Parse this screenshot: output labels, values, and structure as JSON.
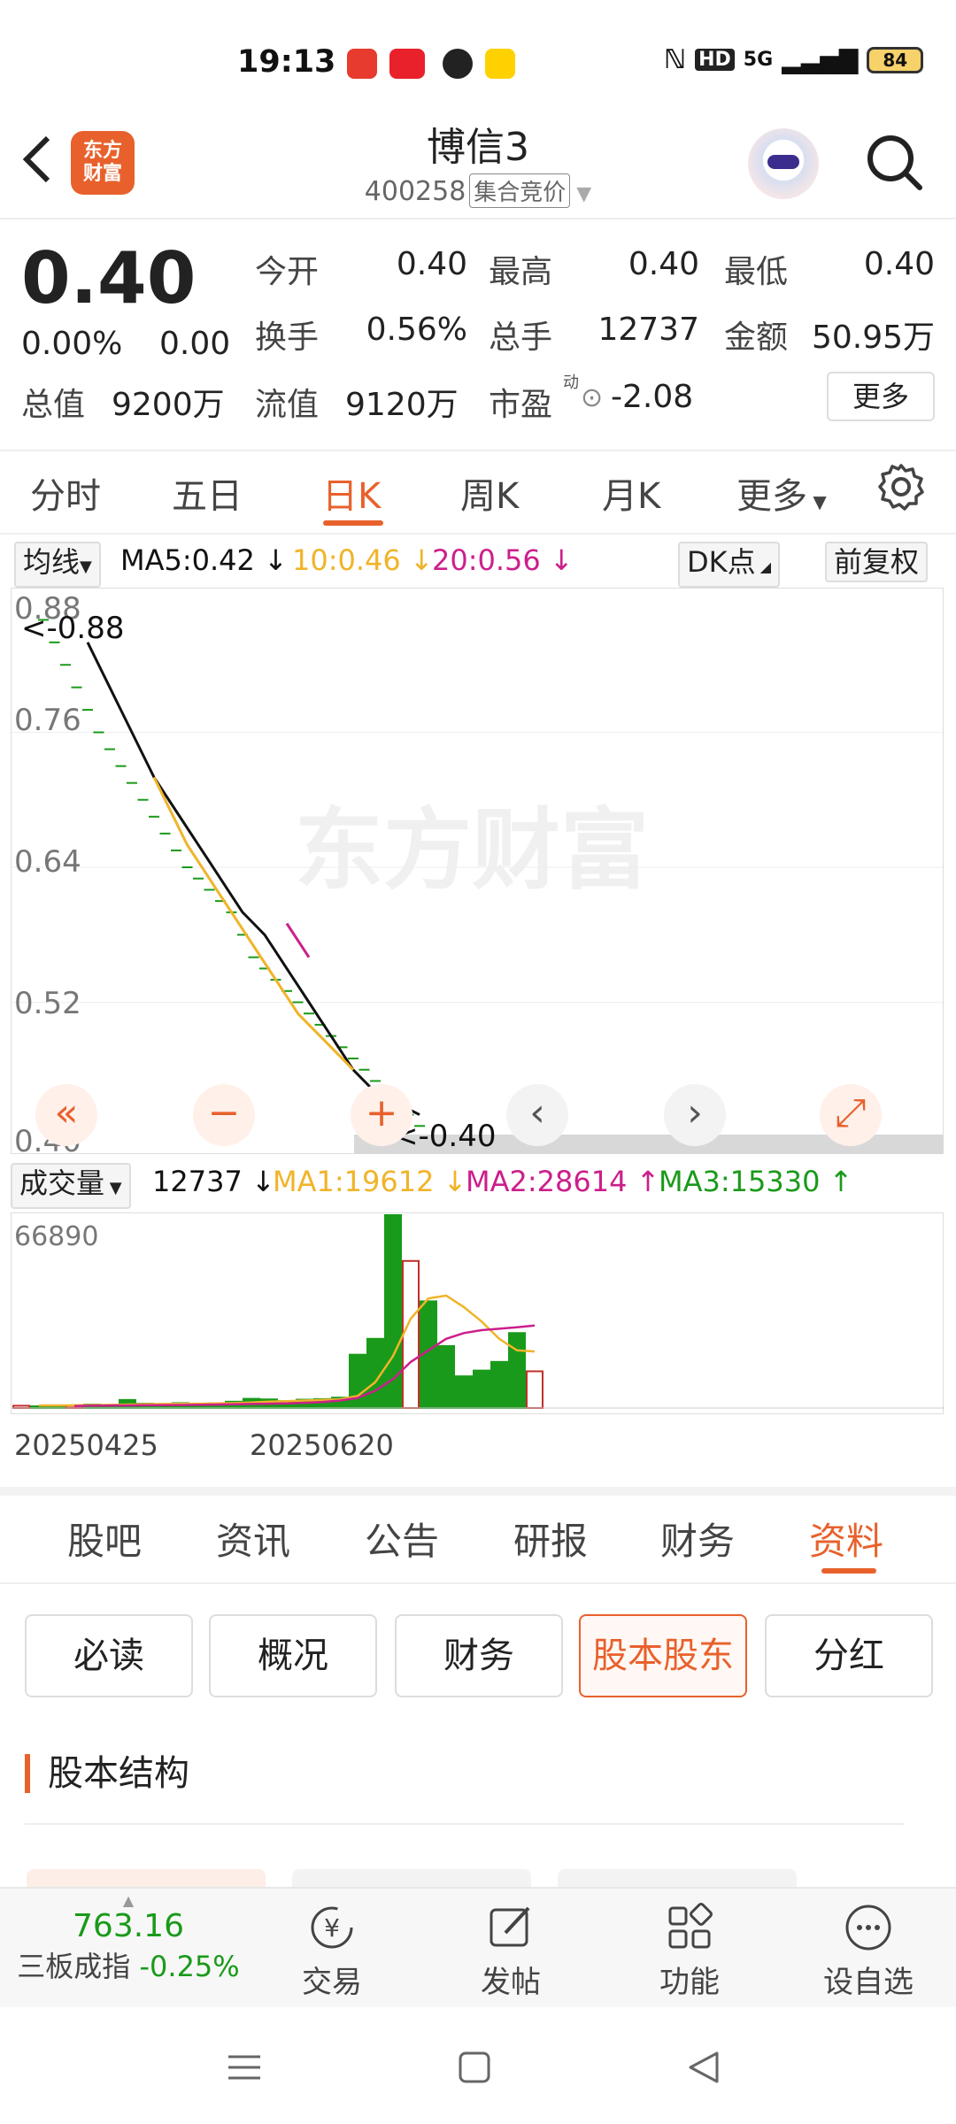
{
  "status_bar": {
    "time": "19:13",
    "icons": [
      "play-app",
      "toutiao-app",
      "feishu-app",
      "meituan-app"
    ],
    "right_labels": {
      "hd": "HD",
      "net": "5G"
    },
    "battery": "84"
  },
  "header": {
    "back": "‹",
    "logo_line1": "东方",
    "logo_line2": "财富",
    "title": "博信3",
    "code": "400258",
    "tag": "集合竞价"
  },
  "quote": {
    "price": "0.40",
    "change_pct": "0.00%",
    "change": "0.00",
    "rows": [
      [
        {
          "label": "今开",
          "value": "0.40"
        },
        {
          "label": "最高",
          "value": "0.40"
        },
        {
          "label": "最低",
          "value": "0.40"
        }
      ],
      [
        {
          "label": "换手",
          "value": "0.56%"
        },
        {
          "label": "总手",
          "value": "12737"
        },
        {
          "label": "金额",
          "value": "50.95万"
        }
      ]
    ],
    "total_value_label": "总值",
    "total_value": "9200万",
    "float_value_label": "流值",
    "float_value": "9120万",
    "pe_label": "市盈",
    "pe_super": "动",
    "pe_value": "-2.08",
    "more": "更多"
  },
  "chart_tabs": {
    "items": [
      "分时",
      "五日",
      "日K",
      "周K",
      "月K",
      "更多"
    ],
    "active": "日K"
  },
  "ma_bar": {
    "selector": "均线",
    "ma5": "MA5:0.42",
    "ma10": "10:0.46",
    "ma20": "20:0.56",
    "dk": "DK点",
    "fq": "前复权"
  },
  "colors": {
    "accent": "#e8612c",
    "ma5": "#111111",
    "ma10": "#f0b429",
    "ma20": "#cc1f8c",
    "down": "#1a9a1a",
    "up": "#c0302a"
  },
  "chart_data": {
    "type": "line",
    "title": "",
    "y_ticks": [
      "0.88",
      "0.76",
      "0.64",
      "0.52",
      "0.40"
    ],
    "ylim": [
      0.4,
      0.88
    ],
    "max_label": "<-0.88",
    "min_label": "<-0.40",
    "watermark": "东方财富",
    "candles_close": [
      0.86,
      0.84,
      0.82,
      0.8,
      0.78,
      0.76,
      0.745,
      0.73,
      0.715,
      0.7,
      0.685,
      0.67,
      0.655,
      0.64,
      0.63,
      0.62,
      0.61,
      0.6,
      0.58,
      0.56,
      0.55,
      0.54,
      0.53,
      0.52,
      0.51,
      0.5,
      0.49,
      0.48,
      0.47,
      0.46,
      0.45,
      0.44,
      0.43,
      0.42,
      0.41,
      0.4
    ],
    "series": [
      {
        "name": "MA5",
        "values": [
          0.84,
          0.82,
          0.8,
          0.78,
          0.76,
          0.74,
          0.72,
          0.705,
          0.69,
          0.675,
          0.66,
          0.645,
          0.63,
          0.615,
          0.6,
          0.59,
          0.58,
          0.565,
          0.55,
          0.535,
          0.52,
          0.505,
          0.49,
          0.475,
          0.46,
          0.45,
          0.44,
          0.435,
          0.43,
          0.425,
          0.42
        ]
      },
      {
        "name": "MA10",
        "values": [
          0.72,
          0.7,
          0.68,
          0.66,
          0.645,
          0.63,
          0.615,
          0.6,
          0.585,
          0.57,
          0.555,
          0.54,
          0.525,
          0.51,
          0.5,
          0.49,
          0.48,
          0.47,
          0.46
        ]
      },
      {
        "name": "MA20",
        "values": [
          0.59,
          0.575,
          0.56
        ]
      }
    ]
  },
  "controls": [
    "«",
    "−",
    "+",
    "‹",
    "›",
    "⤢"
  ],
  "volume_bar": {
    "selector": "成交量",
    "vol": "12737",
    "ma1": "MA1:19612",
    "ma2": "MA2:28614",
    "ma3": "MA3:15330"
  },
  "volume_chart_data": {
    "type": "bar",
    "max_label": "66890",
    "values": [
      800,
      600,
      900,
      700,
      1200,
      900,
      2800,
      1500,
      1200,
      1700,
      1400,
      1600,
      2200,
      3200,
      3000,
      2400,
      2900,
      3100,
      3600,
      18500,
      24000,
      66890,
      51000,
      37000,
      21500,
      11000,
      13000,
      16000,
      26000,
      12737
    ],
    "colors": [
      "up",
      "down",
      "down",
      "up",
      "down",
      "down",
      "down",
      "down",
      "down",
      "down",
      "down",
      "down",
      "down",
      "down",
      "down",
      "down",
      "down",
      "down",
      "down",
      "down",
      "down",
      "down",
      "up",
      "down",
      "down",
      "down",
      "down",
      "down",
      "down",
      "up"
    ],
    "ma1": [
      900,
      900,
      950,
      1000,
      1100,
      1200,
      1300,
      1400,
      1450,
      1500,
      1600,
      1700,
      1900,
      2200,
      2400,
      2600,
      2800,
      3000,
      4200,
      9000,
      18000,
      31000,
      38000,
      39000,
      35000,
      30000,
      24000,
      20000,
      19612
    ],
    "ma2": [
      700,
      800,
      850,
      900,
      950,
      1000,
      1050,
      1100,
      1200,
      1300,
      1400,
      1500,
      1600,
      1800,
      2100,
      2600,
      3500,
      6000,
      10000,
      16000,
      20000,
      24000,
      26000,
      27000,
      27500,
      28000,
      28614
    ]
  },
  "dates": {
    "start": "20250425",
    "end": "20250620"
  },
  "info_tabs": {
    "items": [
      "股吧",
      "资讯",
      "公告",
      "研报",
      "财务",
      "资料"
    ],
    "active": "资料"
  },
  "sub_buttons": {
    "items": [
      "必读",
      "概况",
      "财务",
      "股本股东",
      "分红"
    ],
    "active": "股本股东"
  },
  "section_title": "股本结构",
  "bottom_bar": {
    "index_value": "763.16",
    "index_name": "三板成指",
    "index_change": "-0.25%",
    "trade": "交易",
    "post": "发帖",
    "func": "功能",
    "watch": "设自选"
  }
}
